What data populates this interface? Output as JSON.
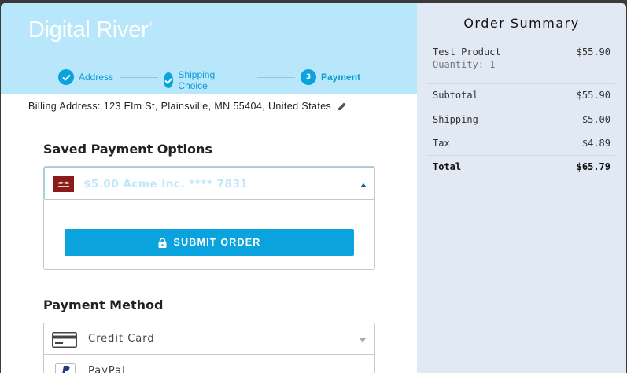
{
  "brand": {
    "name": "Digital River",
    "trademark": "®"
  },
  "steps": [
    {
      "label": "Address",
      "state": "done"
    },
    {
      "label": "Shipping Choice",
      "state": "done"
    },
    {
      "number": "3",
      "label": "Payment",
      "state": "current"
    }
  ],
  "billing": {
    "text": "Billing Address: 123 Elm St, Plainsville, MN 55404, United States"
  },
  "saved_payment": {
    "title": "Saved Payment Options",
    "selected": "$5.00 Acme Inc. **** 7831",
    "submit_label": "SUBMIT ORDER"
  },
  "payment_method": {
    "title": "Payment Method",
    "options": [
      {
        "label": "Credit Card",
        "icon": "credit-card-icon"
      },
      {
        "label": "PayPal",
        "icon": "paypal-icon"
      }
    ]
  },
  "order_summary": {
    "title": "Order Summary",
    "product": {
      "name": "Test Product",
      "price": "$55.90",
      "quantity_label": "Quantity: 1"
    },
    "subtotal": {
      "label": "Subtotal",
      "value": "$55.90"
    },
    "shipping": {
      "label": "Shipping",
      "value": "$5.00"
    },
    "tax": {
      "label": "Tax",
      "value": "$4.89"
    },
    "total": {
      "label": "Total",
      "value": "$65.79"
    }
  },
  "colors": {
    "header_bg": "#b8e6fa",
    "accent": "#0ba3de",
    "summary_bg": "#e1e9f5"
  }
}
